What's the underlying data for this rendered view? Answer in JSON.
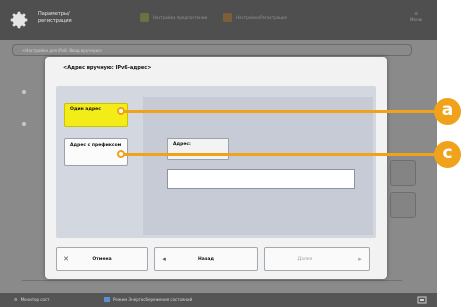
{
  "topbar": {
    "title": "Параметры/регистрация",
    "item1": "Настройка предпочтений",
    "item2": "Настройки/Регистрация",
    "right_label": "Меню"
  },
  "background": {
    "crumb": "<Настройки для IPv6: Ввод вручную>"
  },
  "dialog": {
    "title": "<Адрес вручную: IPv6-адрес>",
    "own_address_label": "Один адрес",
    "prefix_address_label": "Адрес с префиксом",
    "address_tab_label": "Адрес:",
    "address_value": ""
  },
  "footer": {
    "cancel_label": "Отмена",
    "back_label": "Назад",
    "next_label": "Далее"
  },
  "statusbar": {
    "item1": "Монитор сост.",
    "item2": "Режим Энергосбережения состояний"
  },
  "callouts": {
    "a": "a",
    "c": "c"
  },
  "colors": {
    "accent": "#f0a21a",
    "selected_button": "#f4ec18"
  }
}
